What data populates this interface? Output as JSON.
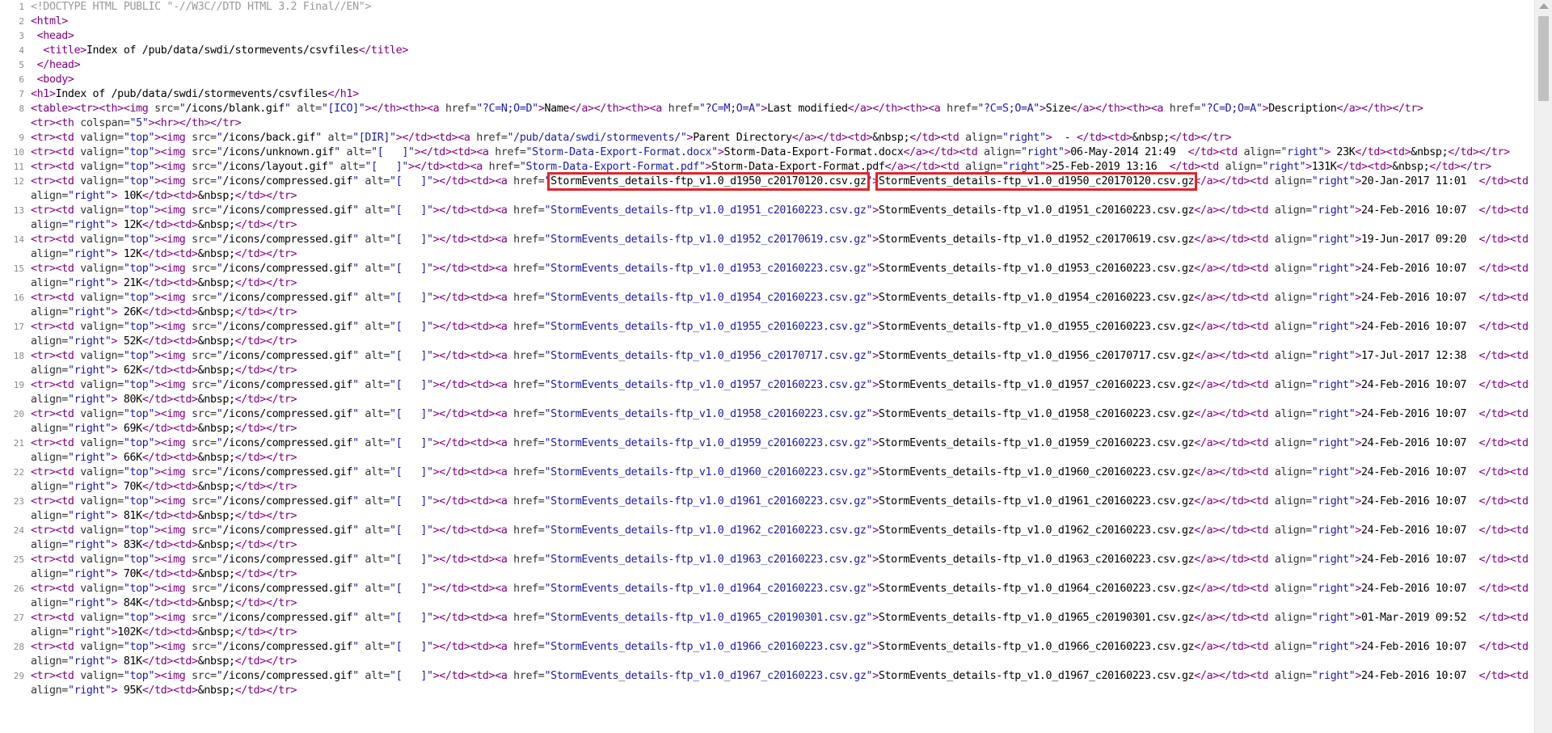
{
  "source": {
    "doctype": "<!DOCTYPE HTML PUBLIC \"-//W3C//DTD HTML 3.2 Final//EN\">",
    "title": "Index of /pub/data/swdi/stormevents/csvfiles",
    "h1": "Index of /pub/data/swdi/stormevents/csvfiles",
    "header_row": {
      "blank_icon": "/icons/blank.gif",
      "blank_alt": "[ICO]",
      "cols": [
        {
          "href": "?C=N;O=D",
          "label": "Name"
        },
        {
          "href": "?C=M;O=A",
          "label": "Last modified"
        },
        {
          "href": "?C=S;O=A",
          "label": "Size"
        },
        {
          "href": "?C=D;O=A",
          "label": "Description"
        }
      ]
    },
    "parent": {
      "icon": "/icons/back.gif",
      "alt": "[DIR]",
      "href": "/pub/data/swdi/stormevents/",
      "label": "Parent Directory"
    },
    "files": [
      {
        "icon": "/icons/unknown.gif",
        "alt": "[   ]",
        "href": "Storm-Data-Export-Format.docx",
        "name": "Storm-Data-Export-Format.docx",
        "date": "06-May-2014 21:49",
        "size": " 23K"
      },
      {
        "icon": "/icons/layout.gif",
        "alt": "[   ]",
        "href": "Storm-Data-Export-Format.pdf",
        "name": "Storm-Data-Export-Format.pdf",
        "date": "25-Feb-2019 13:16",
        "size": "131K"
      },
      {
        "icon": "/icons/compressed.gif",
        "alt": "[   ]",
        "href": "StormEvents_details-ftp_v1.0_d1950_c20170120.csv.gz",
        "name": "StormEvents_details-ftp_v1.0_d1950_c20170120.csv.gz",
        "date": "20-Jan-2017 11:01",
        "size": " 10K"
      },
      {
        "icon": "/icons/compressed.gif",
        "alt": "[   ]",
        "href": "StormEvents_details-ftp_v1.0_d1951_c20160223.csv.gz",
        "name": "StormEvents_details-ftp_v1.0_d1951_c20160223.csv.gz",
        "date": "24-Feb-2016 10:07",
        "size": " 12K"
      },
      {
        "icon": "/icons/compressed.gif",
        "alt": "[   ]",
        "href": "StormEvents_details-ftp_v1.0_d1952_c20170619.csv.gz",
        "name": "StormEvents_details-ftp_v1.0_d1952_c20170619.csv.gz",
        "date": "19-Jun-2017 09:20",
        "size": " 12K"
      },
      {
        "icon": "/icons/compressed.gif",
        "alt": "[   ]",
        "href": "StormEvents_details-ftp_v1.0_d1953_c20160223.csv.gz",
        "name": "StormEvents_details-ftp_v1.0_d1953_c20160223.csv.gz",
        "date": "24-Feb-2016 10:07",
        "size": " 21K"
      },
      {
        "icon": "/icons/compressed.gif",
        "alt": "[   ]",
        "href": "StormEvents_details-ftp_v1.0_d1954_c20160223.csv.gz",
        "name": "StormEvents_details-ftp_v1.0_d1954_c20160223.csv.gz",
        "date": "24-Feb-2016 10:07",
        "size": " 26K"
      },
      {
        "icon": "/icons/compressed.gif",
        "alt": "[   ]",
        "href": "StormEvents_details-ftp_v1.0_d1955_c20160223.csv.gz",
        "name": "StormEvents_details-ftp_v1.0_d1955_c20160223.csv.gz",
        "date": "24-Feb-2016 10:07",
        "size": " 52K"
      },
      {
        "icon": "/icons/compressed.gif",
        "alt": "[   ]",
        "href": "StormEvents_details-ftp_v1.0_d1956_c20170717.csv.gz",
        "name": "StormEvents_details-ftp_v1.0_d1956_c20170717.csv.gz",
        "date": "17-Jul-2017 12:38",
        "size": " 62K"
      },
      {
        "icon": "/icons/compressed.gif",
        "alt": "[   ]",
        "href": "StormEvents_details-ftp_v1.0_d1957_c20160223.csv.gz",
        "name": "StormEvents_details-ftp_v1.0_d1957_c20160223.csv.gz",
        "date": "24-Feb-2016 10:07",
        "size": " 80K"
      },
      {
        "icon": "/icons/compressed.gif",
        "alt": "[   ]",
        "href": "StormEvents_details-ftp_v1.0_d1958_c20160223.csv.gz",
        "name": "StormEvents_details-ftp_v1.0_d1958_c20160223.csv.gz",
        "date": "24-Feb-2016 10:07",
        "size": " 69K"
      },
      {
        "icon": "/icons/compressed.gif",
        "alt": "[   ]",
        "href": "StormEvents_details-ftp_v1.0_d1959_c20160223.csv.gz",
        "name": "StormEvents_details-ftp_v1.0_d1959_c20160223.csv.gz",
        "date": "24-Feb-2016 10:07",
        "size": " 66K"
      },
      {
        "icon": "/icons/compressed.gif",
        "alt": "[   ]",
        "href": "StormEvents_details-ftp_v1.0_d1960_c20160223.csv.gz",
        "name": "StormEvents_details-ftp_v1.0_d1960_c20160223.csv.gz",
        "date": "24-Feb-2016 10:07",
        "size": " 70K"
      },
      {
        "icon": "/icons/compressed.gif",
        "alt": "[   ]",
        "href": "StormEvents_details-ftp_v1.0_d1961_c20160223.csv.gz",
        "name": "StormEvents_details-ftp_v1.0_d1961_c20160223.csv.gz",
        "date": "24-Feb-2016 10:07",
        "size": " 81K"
      },
      {
        "icon": "/icons/compressed.gif",
        "alt": "[   ]",
        "href": "StormEvents_details-ftp_v1.0_d1962_c20160223.csv.gz",
        "name": "StormEvents_details-ftp_v1.0_d1962_c20160223.csv.gz",
        "date": "24-Feb-2016 10:07",
        "size": " 83K"
      },
      {
        "icon": "/icons/compressed.gif",
        "alt": "[   ]",
        "href": "StormEvents_details-ftp_v1.0_d1963_c20160223.csv.gz",
        "name": "StormEvents_details-ftp_v1.0_d1963_c20160223.csv.gz",
        "date": "24-Feb-2016 10:07",
        "size": " 70K"
      },
      {
        "icon": "/icons/compressed.gif",
        "alt": "[   ]",
        "href": "StormEvents_details-ftp_v1.0_d1964_c20160223.csv.gz",
        "name": "StormEvents_details-ftp_v1.0_d1964_c20160223.csv.gz",
        "date": "24-Feb-2016 10:07",
        "size": " 84K"
      },
      {
        "icon": "/icons/compressed.gif",
        "alt": "[   ]",
        "href": "StormEvents_details-ftp_v1.0_d1965_c20190301.csv.gz",
        "name": "StormEvents_details-ftp_v1.0_d1965_c20190301.csv.gz",
        "date": "01-Mar-2019 09:52",
        "size": "102K"
      },
      {
        "icon": "/icons/compressed.gif",
        "alt": "[   ]",
        "href": "StormEvents_details-ftp_v1.0_d1966_c20160223.csv.gz",
        "name": "StormEvents_details-ftp_v1.0_d1966_c20160223.csv.gz",
        "date": "24-Feb-2016 10:07",
        "size": " 81K"
      },
      {
        "icon": "/icons/compressed.gif",
        "alt": "[   ]",
        "href": "StormEvents_details-ftp_v1.0_d1967_c20160223.csv.gz",
        "name": "StormEvents_details-ftp_v1.0_d1967_c20160223.csv.gz",
        "date": "24-Feb-2016 10:07",
        "size": " 95K"
      }
    ]
  },
  "colors": {
    "tag": "#800080",
    "value": "#1a1aa6",
    "highlight": "#e0242a",
    "gutter": "#8a8a8a"
  }
}
